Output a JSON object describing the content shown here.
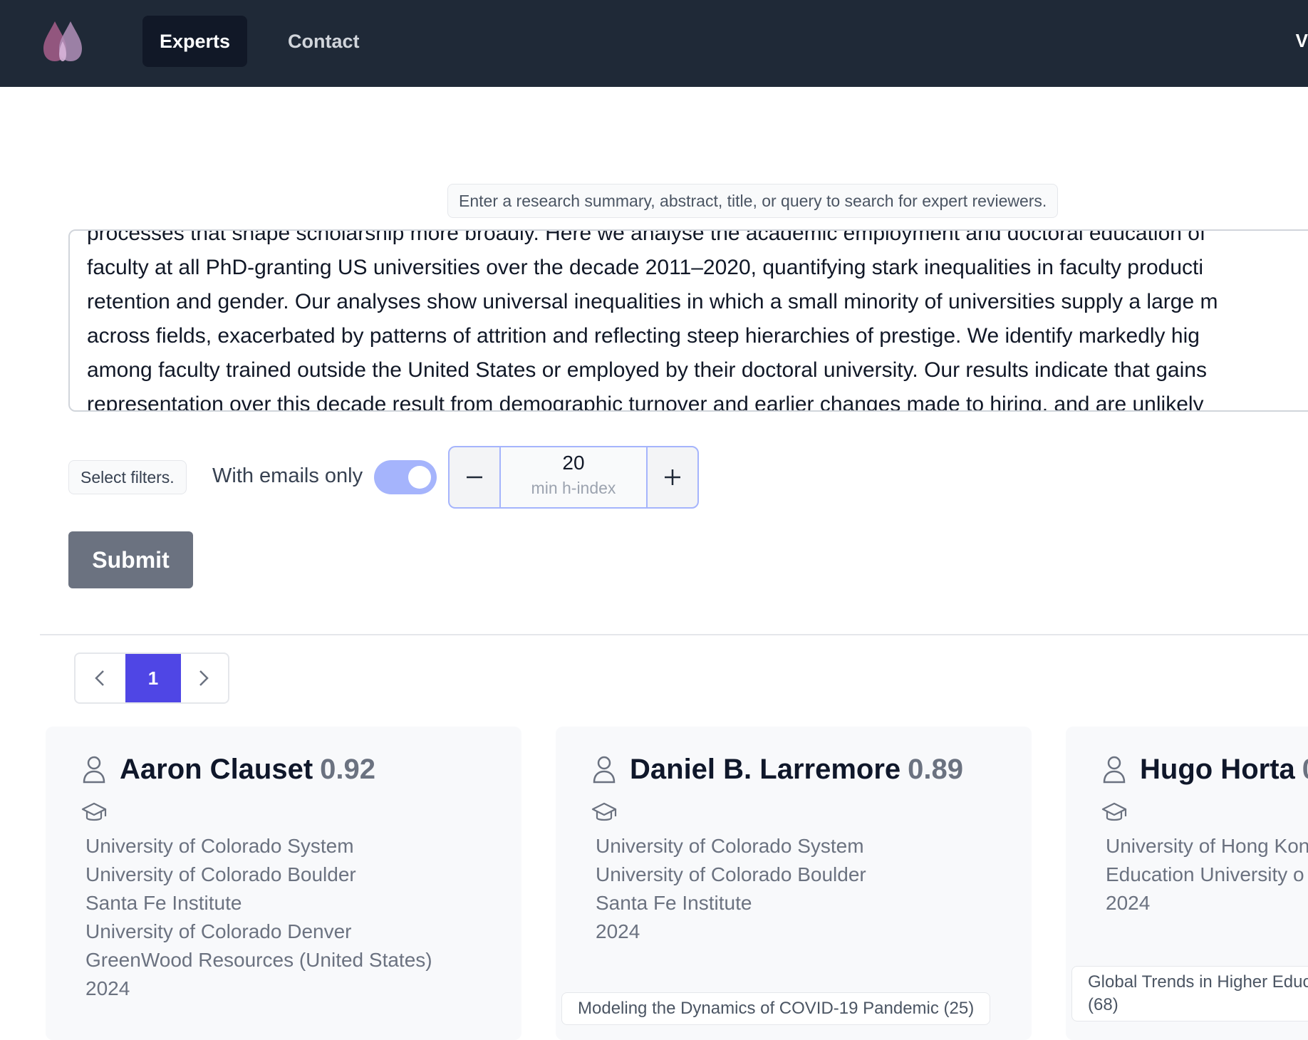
{
  "nav": {
    "tabs": [
      {
        "label": "Experts",
        "active": true
      },
      {
        "label": "Contact",
        "active": false
      }
    ],
    "edge_text": "V"
  },
  "search": {
    "hint": "Enter a research summary, abstract, title, or query to search for expert reviewers.",
    "query_lines": [
      "processes that shape scholarship more broadly. Here we analyse the academic employment and doctoral education of",
      "faculty at all PhD-granting US universities over the decade 2011–2020, quantifying stark inequalities in faculty producti",
      "retention and gender. Our analyses show universal inequalities in which a small minority of universities supply a large m",
      "across fields, exacerbated by patterns of attrition and reflecting steep hierarchies of prestige. We identify markedly hig",
      "among faculty trained outside the United States or employed by their doctoral university. Our results indicate that gains",
      "representation over this decade result from demographic turnover and earlier changes made to hiring, and are unlikely"
    ]
  },
  "filters": {
    "select_label": "Select filters.",
    "emails_label": "With emails only",
    "emails_only": true,
    "h_index": {
      "value": "20",
      "label": "min h-index",
      "minus": "−",
      "plus": "+"
    }
  },
  "submit_label": "Submit",
  "pagination": {
    "current_page": "1"
  },
  "experts": [
    {
      "name": "Aaron Clauset",
      "score": "0.92",
      "affiliations": [
        "University of Colorado System",
        "University of Colorado Boulder",
        "Santa Fe Institute",
        "University of Colorado Denver",
        "GreenWood Resources (United States)",
        "2024"
      ],
      "topic": ""
    },
    {
      "name": "Daniel B. Larremore",
      "score": "0.89",
      "affiliations": [
        "University of Colorado System",
        "University of Colorado Boulder",
        "Santa Fe Institute",
        "2024"
      ],
      "topic": "Modeling the Dynamics of COVID-19 Pandemic (25)"
    },
    {
      "name": "Hugo Horta",
      "score": "0",
      "affiliations": [
        "University of Hong Kon",
        "Education University o",
        "2024"
      ],
      "topic": "Global Trends in Higher Educ\n(68)"
    }
  ],
  "colors": {
    "navbar": "#1f2937",
    "accent": "#4f46e5",
    "toggle_on": "#a5b4fc",
    "submit": "#6b7280"
  }
}
